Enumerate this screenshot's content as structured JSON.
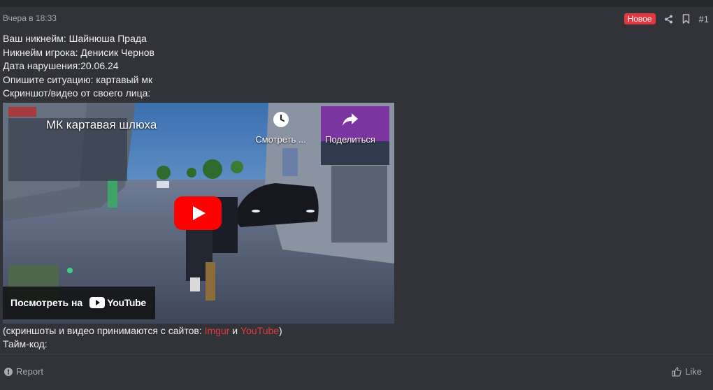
{
  "post": {
    "date": "Вчера в 18:33",
    "badge": "Новое",
    "number": "#1",
    "lines": {
      "nickname": "Ваш никнейм: Шайнюша Прада",
      "player": "Никнейм игрока: Денисик Чернов",
      "date": "Дата нарушения:20.06.24",
      "situation": "Опишите ситуацию: картавый мк",
      "screenshot": "Скриншот/видео от своего лица:"
    },
    "video": {
      "title": "МК картавая шлюха",
      "watch_later": "Смотреть ...",
      "share": "Поделиться",
      "watch_on": "Посмотреть на",
      "youtube": "YouTube"
    },
    "note": {
      "prefix": "(скриншоты и видео принимаются с сайтов: ",
      "link1": "Imgur",
      "and": " и ",
      "link2": "YouTube",
      "suffix": ")"
    },
    "timecode": "Тайм-код:"
  },
  "footer": {
    "report": "Report",
    "like": "Like"
  },
  "colors": {
    "background": "#323338",
    "accent_red": "#e0383e",
    "muted_text": "#a6a7ac"
  },
  "icons": [
    "share-icon",
    "bookmark-icon",
    "clock-icon",
    "share-arrow-icon",
    "play-icon",
    "youtube-logo-icon",
    "report-icon",
    "thumbs-up-icon"
  ]
}
